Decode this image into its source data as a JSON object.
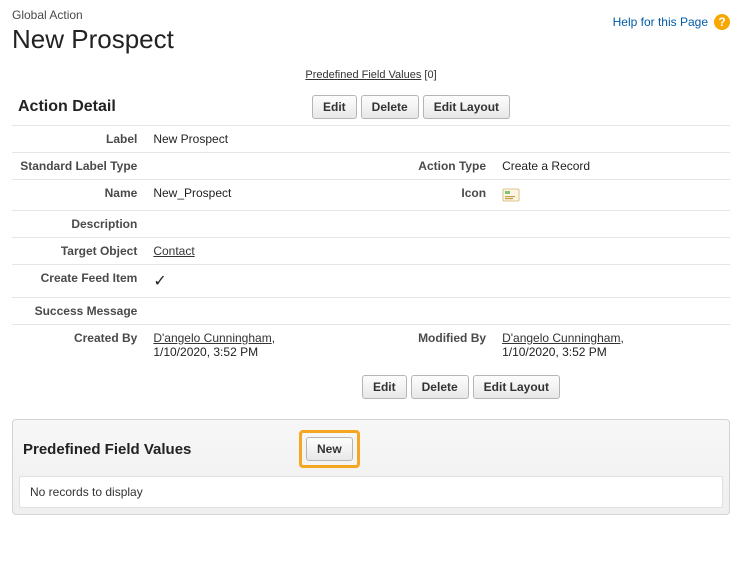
{
  "header": {
    "superhead": "Global Action",
    "title": "New Prospect",
    "help_link": "Help for this Page",
    "help_icon_glyph": "?"
  },
  "anchor": {
    "label": "Predefined Field Values",
    "count": "[0]"
  },
  "section": {
    "title": "Action Detail",
    "buttons": {
      "edit": "Edit",
      "delete": "Delete",
      "edit_layout": "Edit Layout"
    }
  },
  "detail": {
    "labels": {
      "label": "Label",
      "standard_label_type": "Standard Label Type",
      "name": "Name",
      "description": "Description",
      "target_object": "Target Object",
      "create_feed_item": "Create Feed Item",
      "success_message": "Success Message",
      "created_by": "Created By",
      "action_type": "Action Type",
      "icon": "Icon",
      "modified_by": "Modified By"
    },
    "values": {
      "label": "New Prospect",
      "standard_label_type": "",
      "name": "New_Prospect",
      "description": "",
      "target_object": "Contact",
      "create_feed_item_glyph": "✓",
      "success_message": "",
      "created_by_name": "D'angelo Cunningham",
      "created_by_sep": ", ",
      "created_by_date": "1/10/2020, 3:52 PM",
      "action_type": "Create a Record",
      "modified_by_name": "D'angelo Cunningham",
      "modified_by_sep": ", ",
      "modified_by_date": "1/10/2020, 3:52 PM"
    }
  },
  "related": {
    "title": "Predefined Field Values",
    "new_button": "New",
    "empty_text": "No records to display"
  }
}
